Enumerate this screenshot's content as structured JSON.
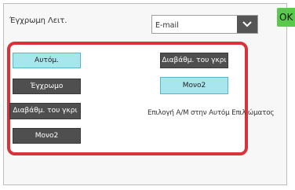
{
  "header": {
    "title": "Έγχρωμη Λειτ.",
    "destination_value": "E-mail",
    "ok_label": "OK"
  },
  "options": {
    "auto": "Αυτόμ.",
    "color": "Έγχρωμο",
    "grayscale_left": "Διαβάθμ. του γκρι",
    "mono_left": "Μονο2",
    "grayscale_right": "Διαβάθμ. του γκρι",
    "mono_right": "Μονο2",
    "bw_auto_label": "Επιλογή Α/Μ στην Αυτόμ Επιλ  ώματος"
  },
  "icons": {
    "dropdown": "chevron-down-icon"
  },
  "colors": {
    "accent_selected": "#a8e6ee",
    "button_dark": "#4f4f4f",
    "highlight_frame": "#d7333b",
    "ok_button": "#58c94b"
  }
}
